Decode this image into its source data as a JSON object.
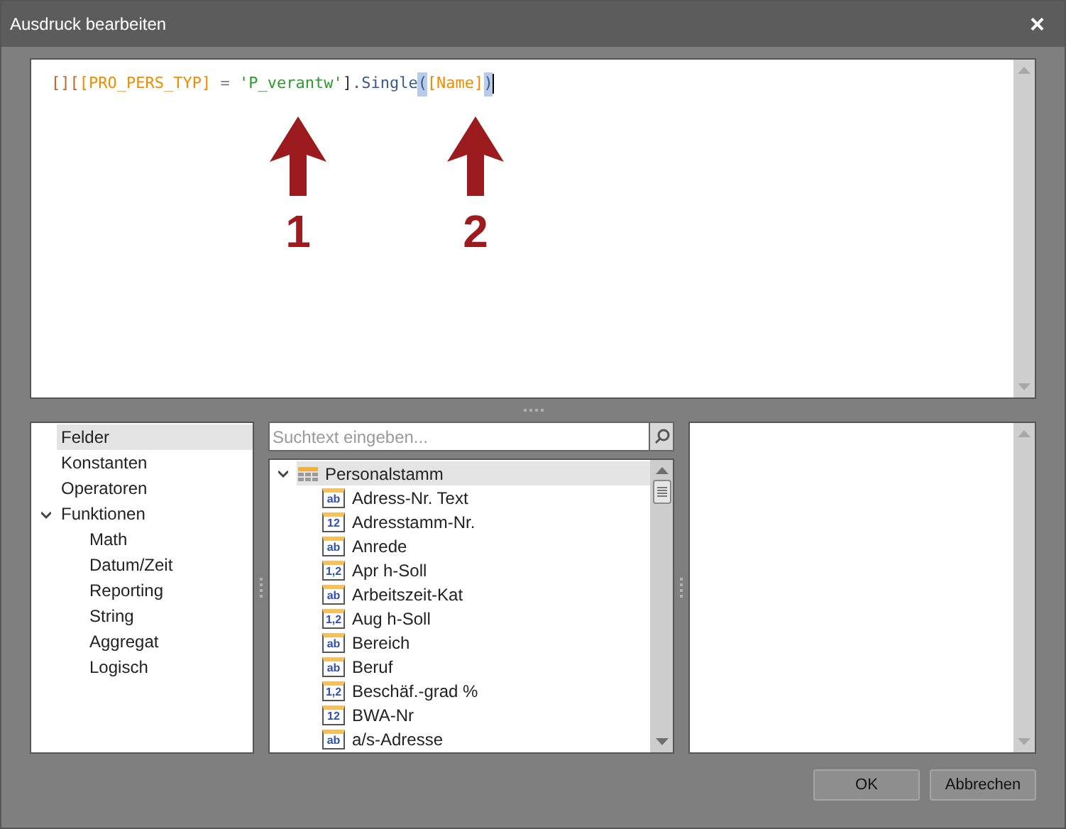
{
  "window": {
    "title": "Ausdruck bearbeiten",
    "close": "×"
  },
  "editor": {
    "tokens": [
      {
        "text": "[][",
        "kind": "bracket"
      },
      {
        "text": "[PRO_PERS_TYP]",
        "kind": "field"
      },
      {
        "text": " = ",
        "kind": "operator"
      },
      {
        "text": "'P_verantw'",
        "kind": "string"
      },
      {
        "text": "]",
        "kind": "plain"
      },
      {
        "text": ".Single",
        "kind": "method"
      },
      {
        "text": "(",
        "kind": "match"
      },
      {
        "text": "[Name]",
        "kind": "field"
      },
      {
        "text": ")",
        "kind": "match"
      }
    ],
    "annotations": [
      {
        "label": "1"
      },
      {
        "label": "2"
      }
    ]
  },
  "categories": [
    {
      "label": "Felder",
      "selected": true
    },
    {
      "label": "Konstanten",
      "selected": false
    },
    {
      "label": "Operatoren",
      "selected": false
    },
    {
      "label": "Funktionen",
      "selected": false,
      "expanded": true,
      "children": [
        {
          "label": "Math",
          "selected": false
        },
        {
          "label": "Datum/Zeit",
          "selected": false
        },
        {
          "label": "Reporting",
          "selected": false
        },
        {
          "label": "String",
          "selected": false
        },
        {
          "label": "Aggregat",
          "selected": false
        },
        {
          "label": "Logisch",
          "selected": false
        }
      ]
    }
  ],
  "search": {
    "placeholder": "Suchtext eingeben..."
  },
  "fields": {
    "group": "Personalstamm",
    "expanded": true,
    "items": [
      {
        "label": "Adress-Nr. Text",
        "type_label": "ab"
      },
      {
        "label": "Adresstamm-Nr.",
        "type_label": "12"
      },
      {
        "label": "Anrede",
        "type_label": "ab"
      },
      {
        "label": "Apr h-Soll",
        "type_label": "1,2"
      },
      {
        "label": "Arbeitszeit-Kat",
        "type_label": "ab"
      },
      {
        "label": "Aug h-Soll",
        "type_label": "1,2"
      },
      {
        "label": "Bereich",
        "type_label": "ab"
      },
      {
        "label": "Beruf",
        "type_label": "ab"
      },
      {
        "label": "Beschäf.-grad %",
        "type_label": "1,2"
      },
      {
        "label": "BWA-Nr",
        "type_label": "12"
      },
      {
        "label": "a/s-Adresse",
        "type_label": "ab"
      }
    ]
  },
  "buttons": [
    {
      "label": "OK"
    },
    {
      "label": "Abbrechen"
    }
  ]
}
